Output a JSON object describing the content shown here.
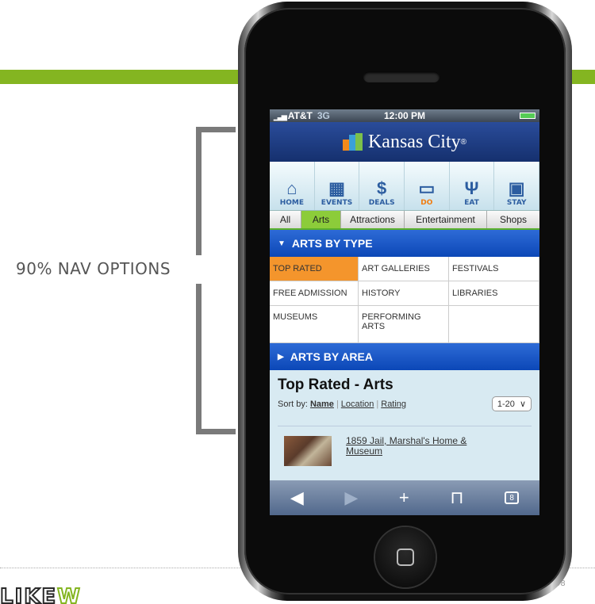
{
  "slide": {
    "label": "90% NAV OPTIONS",
    "logo_left": "LIKE",
    "logo_right": "W",
    "page_number": "08",
    "accent": "#84b521"
  },
  "phone": {
    "status": {
      "carrier": "AT&T",
      "network": "3G",
      "time": "12:00 PM"
    },
    "header": {
      "title": "Kansas City",
      "reg": "®"
    },
    "nav": [
      {
        "label": "HOME",
        "icon": "house-icon"
      },
      {
        "label": "EVENTS",
        "icon": "calendar-icon"
      },
      {
        "label": "DEALS",
        "icon": "dollar-icon"
      },
      {
        "label": "DO",
        "icon": "ticket-icon"
      },
      {
        "label": "EAT",
        "icon": "utensils-icon"
      },
      {
        "label": "STAY",
        "icon": "suitcase-icon"
      }
    ],
    "subtabs": [
      "All",
      "Arts",
      "Attractions",
      "Entertainment",
      "Shops"
    ],
    "section1": "ARTS BY TYPE",
    "types": [
      "TOP RATED",
      "ART GALLERIES",
      "FESTIVALS",
      "FREE ADMISSION",
      "HISTORY",
      "LIBRARIES",
      "MUSEUMS",
      "PERFORMING ARTS",
      ""
    ],
    "section2": "ARTS BY AREA",
    "list": {
      "title": "Top Rated - Arts",
      "sort_prefix": "Sort by:",
      "sort_name": "Name",
      "sort_location": "Location",
      "sort_rating": "Rating",
      "range": "1-20",
      "result_line1": "1859 Jail, Marshal's Home &",
      "result_line2": "Museum"
    },
    "toolbar": {
      "tabs_count": "8"
    }
  }
}
